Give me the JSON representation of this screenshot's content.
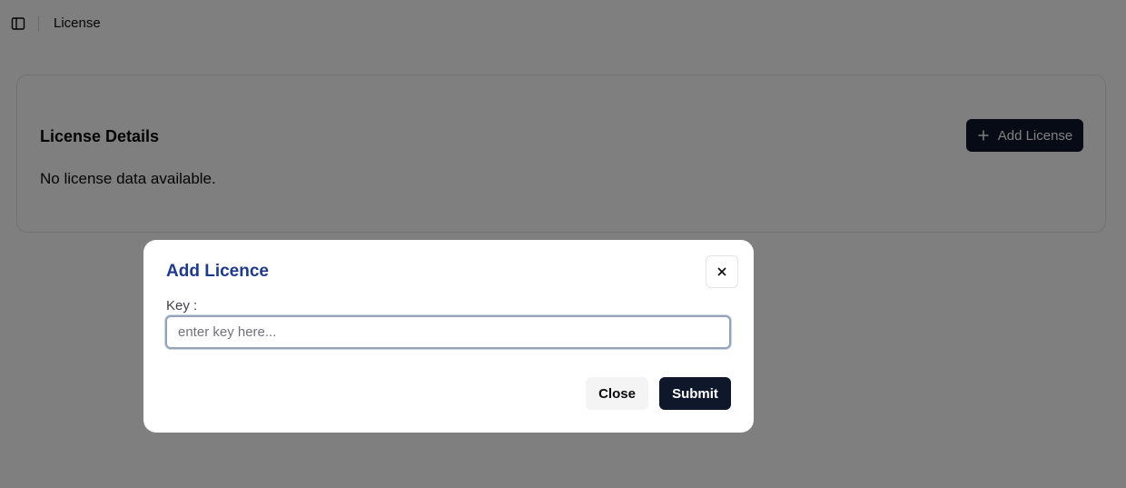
{
  "header": {
    "toggle_icon": "sidebar-toggle-icon",
    "breadcrumb": "License"
  },
  "card": {
    "title": "License Details",
    "empty_message": "No license data available.",
    "add_button_label": "Add License",
    "add_button_icon": "plus-icon"
  },
  "modal": {
    "title": "Add Licence",
    "close_icon": "close-icon",
    "key_label": "Key :",
    "key_placeholder": "enter key here...",
    "key_value": "",
    "close_label": "Close",
    "submit_label": "Submit"
  },
  "colors": {
    "primary": "#0f172a",
    "modal_title": "#1e3a8a",
    "overlay": "rgba(0,0,0,0.5)"
  }
}
